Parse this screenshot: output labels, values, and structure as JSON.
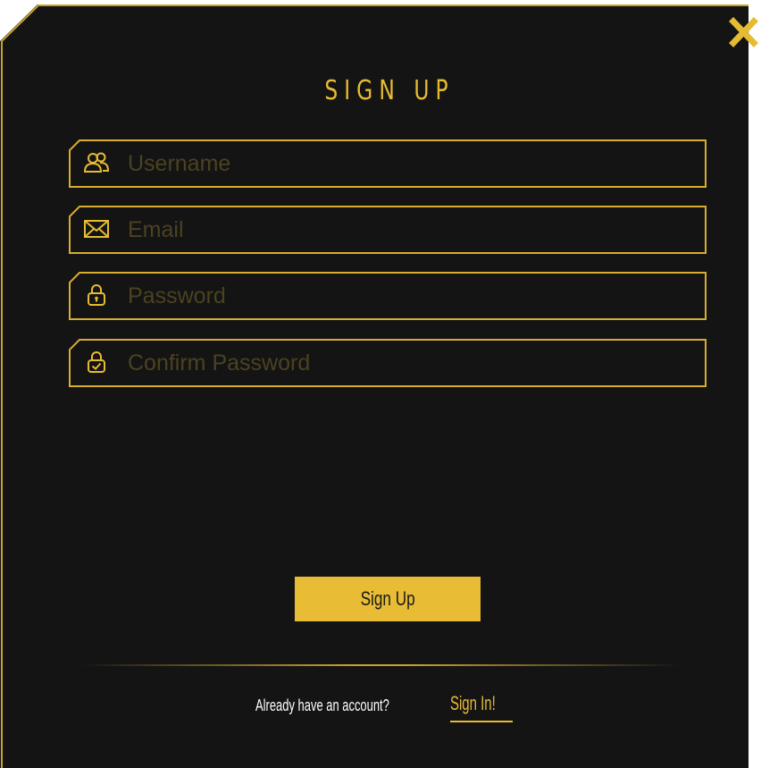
{
  "dialog": {
    "title": "SIGN UP",
    "close_icon": "close-icon"
  },
  "fields": {
    "username": {
      "placeholder": "Username",
      "value": "",
      "icon": "users-icon"
    },
    "email": {
      "placeholder": "Email",
      "value": "",
      "icon": "envelope-icon"
    },
    "password": {
      "placeholder": "Password",
      "value": "",
      "icon": "lock-icon"
    },
    "confirm_password": {
      "placeholder": "Confirm Password",
      "value": "",
      "icon": "lock-check-icon"
    }
  },
  "actions": {
    "submit_label": "Sign Up"
  },
  "footer": {
    "question": "Already have an account?",
    "signin_label": "Sign In!"
  },
  "colors": {
    "accent": "#e6bb34",
    "panel": "#141414",
    "placeholder": "#4b4220"
  }
}
